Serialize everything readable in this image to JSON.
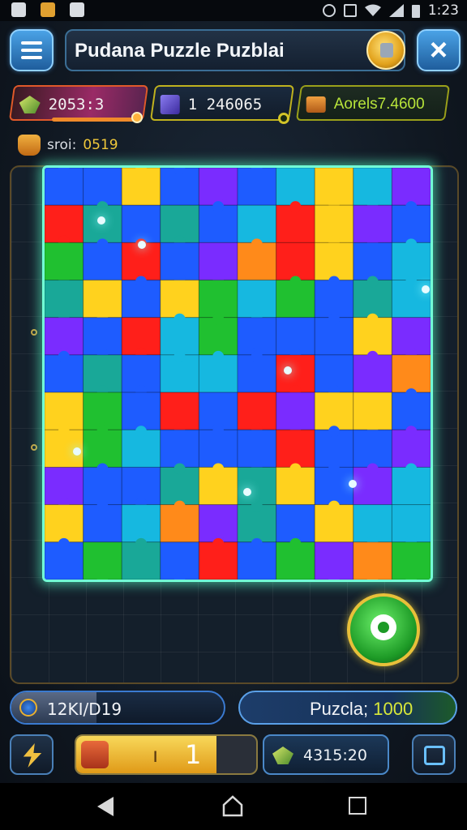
{
  "status_bar": {
    "time": "1:23",
    "icons": [
      "shield-icon",
      "notification-icon",
      "image-icon",
      "alarm-icon",
      "mute-icon",
      "wifi-icon",
      "signal-icon",
      "battery-icon"
    ]
  },
  "header": {
    "title": "Pudana Puzzle Puzblai",
    "icons": [
      "menu-icon",
      "lock-badge-icon",
      "close-icon"
    ]
  },
  "stats": {
    "gems": "2053:3",
    "cubes": "1 246065",
    "awards": "Aorels7.4600",
    "gems_progress": 0.72
  },
  "score": {
    "label": "sroi:",
    "value": "0519"
  },
  "puzzle": {
    "colors": [
      "#1e5cff",
      "#ff1f1a",
      "#20c030",
      "#ffd21e",
      "#7a2cff",
      "#16b8e0",
      "#ff8a1a",
      "#19a898"
    ]
  },
  "controls": {
    "coins_text": "12KI/D19",
    "coins_fill": 0.4,
    "puzzle_label": "Puzcla;",
    "puzzle_count": "1000",
    "level": "1",
    "level_tick": "ı",
    "level_fill": 0.78,
    "gems_total": "4315:20"
  },
  "nav": {
    "icons": [
      "back-icon",
      "home-icon",
      "recents-icon"
    ]
  }
}
